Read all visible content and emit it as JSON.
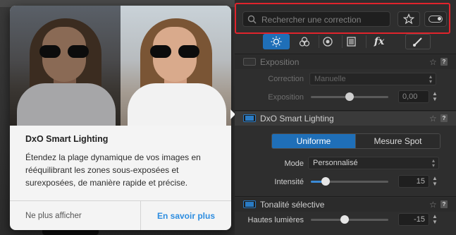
{
  "search": {
    "placeholder": "Rechercher une correction"
  },
  "tabs": [
    {
      "icon": "sun-icon",
      "active": true
    },
    {
      "icon": "color-circles-icon"
    },
    {
      "icon": "lens-icon"
    },
    {
      "icon": "geometry-icon"
    },
    {
      "icon": "fx-icon",
      "label": "fx"
    },
    {
      "icon": "brush-icon"
    }
  ],
  "sections": {
    "exposure": {
      "title": "Exposition",
      "correction_label": "Correction",
      "correction_value": "Manuelle",
      "exposure_label": "Exposition",
      "exposure_value": "0,00",
      "exposure_level": 0.5
    },
    "smart_lighting": {
      "title": "DxO Smart Lighting",
      "mode_uniform": "Uniforme",
      "mode_spot": "Mesure Spot",
      "mode_label": "Mode",
      "mode_value": "Personnalisé",
      "intensity_label": "Intensité",
      "intensity_value": "15",
      "intensity_level": 0.15
    },
    "selective_tone": {
      "title": "Tonalité sélective",
      "highlights_label": "Hautes lumières",
      "highlights_value": "-15",
      "highlights_level": 0.43
    }
  },
  "popup": {
    "title": "DxO Smart Lighting",
    "description": "Étendez la plage dynamique de vos images en rééquilibrant les zones sous-exposées et surexposées, de manière rapide et précise.",
    "dismiss_label": "Ne plus afficher",
    "learn_more_label": "En savoir plus"
  },
  "colors": {
    "accent": "#1f6fb8",
    "link": "#2d8de0",
    "highlight_border": "#e0242c"
  }
}
